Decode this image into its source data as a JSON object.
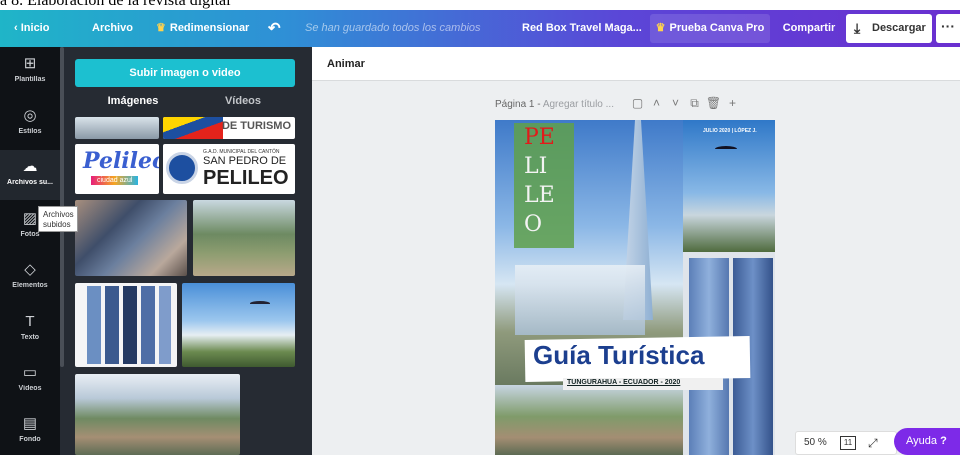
{
  "caption": "a 8. Elaboración de la revista digital",
  "topbar": {
    "home": "Inicio",
    "file": "Archivo",
    "resize": "Redimensionar",
    "undo_icon": "undo-icon",
    "saved_status": "Se han guardado todos los cambios",
    "design_title": "Red Box Travel Maga...",
    "pro": "Prueba Canva Pro",
    "share": "Compartir",
    "download": "Descargar",
    "more": "···"
  },
  "rail": {
    "items": [
      {
        "label": "Plantillas",
        "icon": "templates-icon"
      },
      {
        "label": "Estilos",
        "icon": "palette-icon"
      },
      {
        "label": "Archivos su...",
        "icon": "upload-cloud-icon"
      },
      {
        "label": "Fotos",
        "icon": "photo-icon"
      },
      {
        "label": "Elementos",
        "icon": "shapes-icon"
      },
      {
        "label": "Texto",
        "icon": "text-icon"
      },
      {
        "label": "Vídeos",
        "icon": "video-icon"
      },
      {
        "label": "Fondo",
        "icon": "background-icon"
      }
    ],
    "tooltip": "Archivos subidos"
  },
  "panel": {
    "upload_button": "Subir imagen o video",
    "tabs": [
      "Imágenes",
      "Vídeos"
    ],
    "thumb_texts": {
      "turismo": "DE TURISMO",
      "pelileo_logo": "Pelileo",
      "pelileo_sub": "ciudad azul",
      "gad_line": "G.A.D. MUNICIPAL DEL CANTÓN",
      "gad_name1": "SAN PEDRO DE",
      "gad_name2": "PELILEO"
    }
  },
  "editor": {
    "animate": "Animar",
    "page_label": "Página 1 -",
    "page_title_placeholder": "Agregar título ...",
    "page_icons": [
      "note-icon",
      "chevron-up-icon",
      "chevron-down-icon",
      "copy-icon",
      "trash-icon",
      "plus-icon"
    ]
  },
  "design": {
    "title_letters": [
      "PE",
      "LI",
      "LE",
      "O"
    ],
    "date_strip": "JULIO 2020 | LÓPEZ J.",
    "headline": "Guía Turística",
    "subline": "TUNGURAHUA - ECUADOR - 2020"
  },
  "footer": {
    "zoom": "50 %",
    "page_count": "11",
    "help": "Ayuda",
    "help_mark": "?"
  }
}
